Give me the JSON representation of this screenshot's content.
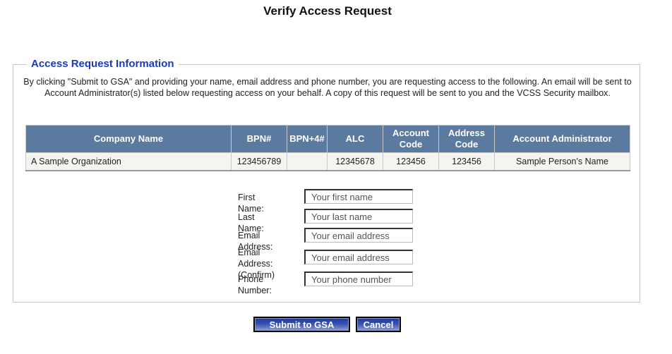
{
  "page": {
    "title": "Verify Access Request"
  },
  "section": {
    "legend": "Access Request Information",
    "intro": "By clicking \"Submit to GSA\" and providing your name, email address and phone number, you are requesting access to the following. An email will be sent to Account Administrator(s) listed below requesting access on your behalf. A copy of this request will be sent to you and the VCSS Security mailbox."
  },
  "table": {
    "headers": [
      "Company Name",
      "BPN#",
      "BPN+4#",
      "ALC",
      "Account Code",
      "Address Code",
      "Account Administrator"
    ],
    "rows": [
      [
        "A Sample Organization",
        "123456789",
        "",
        "12345678",
        "123456",
        "123456",
        "Sample Person's Name"
      ]
    ]
  },
  "form": {
    "fields": [
      {
        "label": "First Name:",
        "placeholder": "Your first name",
        "value": ""
      },
      {
        "label": "Last Name:",
        "placeholder": "Your last name",
        "value": ""
      },
      {
        "label": "Email Address:",
        "placeholder": "Your email address",
        "value": ""
      },
      {
        "label": "Email Address:",
        "sublabel": "(Confirm)",
        "placeholder": "Your email address",
        "value": ""
      },
      {
        "label": "Phone Number:",
        "placeholder": "Your phone number",
        "value": ""
      }
    ]
  },
  "buttons": {
    "submit": "Submit to GSA",
    "cancel": "Cancel"
  },
  "colors": {
    "header_bg": "#5b7aa0",
    "legend": "#1a3bb8",
    "button": "#2a44a5"
  }
}
